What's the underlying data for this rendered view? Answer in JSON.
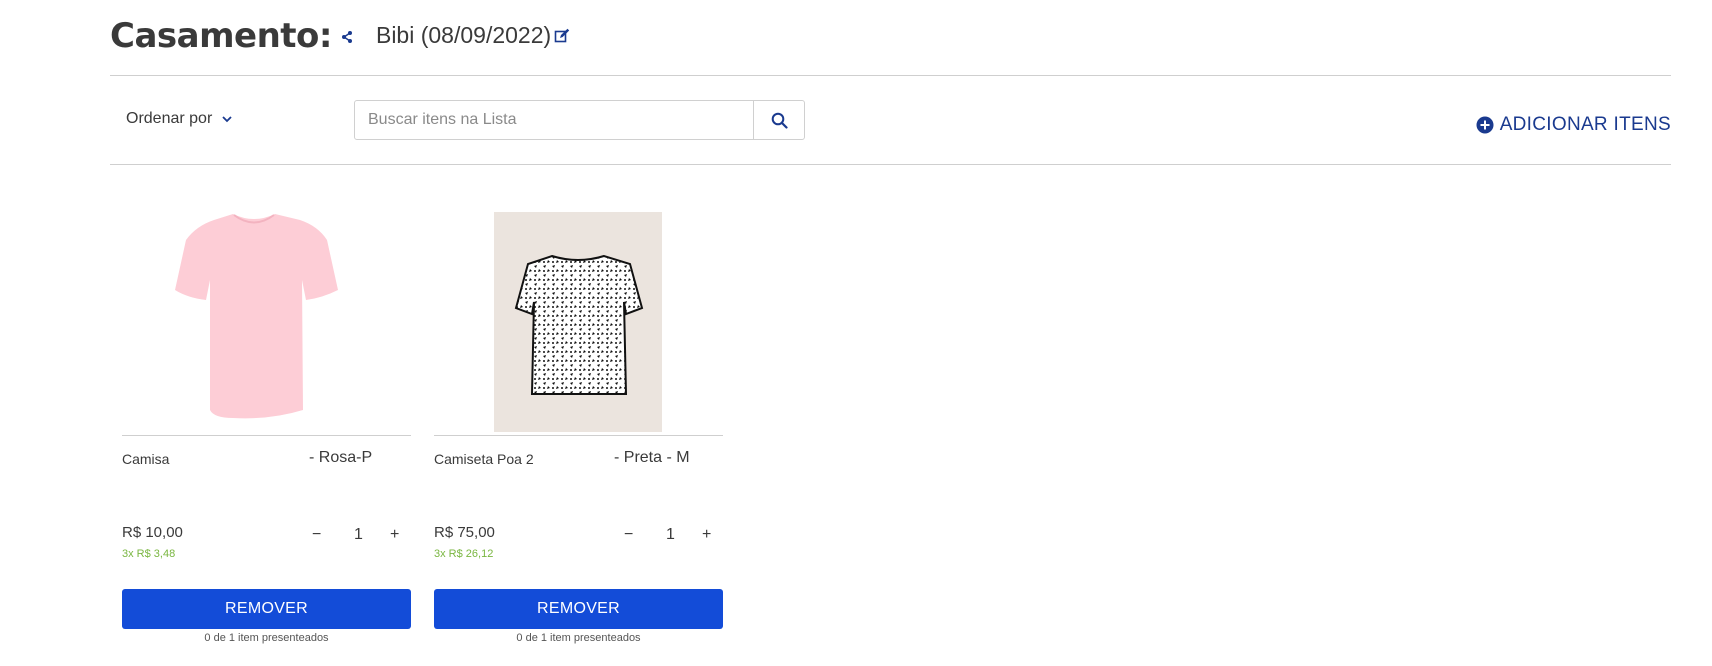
{
  "header": {
    "title": "Casamento:",
    "list_name": "Bibi (08/09/2022)"
  },
  "toolbar": {
    "sort_label": "Ordenar por",
    "search_placeholder": "Buscar itens na Lista",
    "search_value": "",
    "add_label": "ADICIONAR ITENS"
  },
  "colors": {
    "accent": "#134cd8",
    "link": "#1a3a8f",
    "installment": "#79b640"
  },
  "products": [
    {
      "name": "Camisa",
      "variant": "- Rosa-P",
      "price": "R$ 10,00",
      "installments": "3x R$ 3,48",
      "quantity": "1",
      "minus": "−",
      "plus": "+",
      "button": "REMOVER",
      "gifted": "0 de 1 item presenteados",
      "image": "pink-tshirt"
    },
    {
      "name": "Camiseta Poa 2",
      "variant": "- Preta - M",
      "price": "R$ 75,00",
      "installments": "3x R$ 26,12",
      "quantity": "1",
      "minus": "−",
      "plus": "+",
      "button": "REMOVER",
      "gifted": "0 de 1 item presenteados",
      "image": "polka-dot-tshirt"
    }
  ]
}
